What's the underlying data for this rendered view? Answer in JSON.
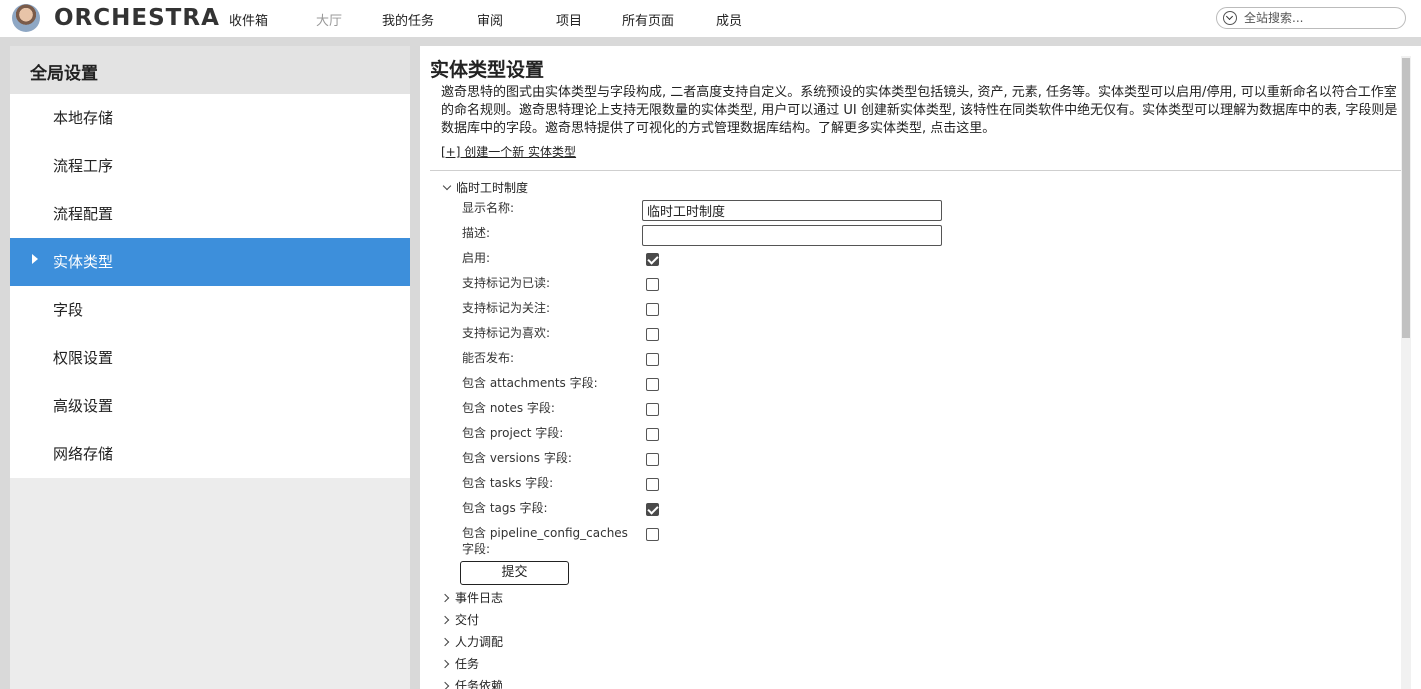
{
  "app": {
    "brand": "ORCHESTRA",
    "avatar_icon": "user-avatar-icon"
  },
  "nav": [
    {
      "label": "收件箱",
      "enabled": true
    },
    {
      "label": "大厅",
      "enabled": false
    },
    {
      "label": "我的任务",
      "enabled": true
    },
    {
      "label": "审阅",
      "enabled": true
    },
    {
      "label": "项目",
      "enabled": true
    },
    {
      "label": "所有页面",
      "enabled": true
    },
    {
      "label": "成员",
      "enabled": true
    }
  ],
  "search": {
    "placeholder": "全站搜索..."
  },
  "sidebar": {
    "title": "全局设置",
    "items": [
      {
        "label": "本地存储"
      },
      {
        "label": "流程工序"
      },
      {
        "label": "流程配置"
      },
      {
        "label": "实体类型",
        "active": true
      },
      {
        "label": "字段"
      },
      {
        "label": "权限设置"
      },
      {
        "label": "高级设置"
      },
      {
        "label": "网络存储"
      }
    ]
  },
  "main": {
    "title": "实体类型设置",
    "description": "邀奇思特的图式由实体类型与字段构成, 二者高度支持自定义。系统预设的实体类型包括镜头, 资产, 元素, 任务等。实体类型可以启用/停用, 可以重新命名以符合工作室的命名规则。邀奇思特理论上支持无限数量的实体类型, 用户可以通过 UI 创建新实体类型, 该特性在同类软件中绝无仅有。实体类型可以理解为数据库中的表, 字段则是数据库中的字段。邀奇思特提供了可视化的方式管理数据库结构。了解更多实体类型, 点击这里。",
    "create_link": "[+] 创建一个新 实体类型",
    "expanded_section": {
      "title": "临时工时制度",
      "fields": {
        "display_name": {
          "label": "显示名称:",
          "value": "临时工时制度"
        },
        "description": {
          "label": "描述:",
          "value": ""
        }
      },
      "checkboxes": [
        {
          "label": "启用:",
          "checked": true
        },
        {
          "label": "支持标记为已读:",
          "checked": false
        },
        {
          "label": "支持标记为关注:",
          "checked": false
        },
        {
          "label": "支持标记为喜欢:",
          "checked": false
        },
        {
          "label": "能否发布:",
          "checked": false
        },
        {
          "label": "包含 attachments 字段:",
          "checked": false
        },
        {
          "label": "包含 notes 字段:",
          "checked": false
        },
        {
          "label": "包含 project 字段:",
          "checked": false
        },
        {
          "label": "包含 versions 字段:",
          "checked": false
        },
        {
          "label": "包含 tasks 字段:",
          "checked": false
        },
        {
          "label": "包含 tags 字段:",
          "checked": true
        },
        {
          "label": "包含 pipeline_config_caches 字段:",
          "checked": false
        }
      ],
      "submit_label": "提交"
    },
    "collapsed_sections": [
      {
        "title": "事件日志"
      },
      {
        "title": "交付"
      },
      {
        "title": "人力调配"
      },
      {
        "title": "任务"
      },
      {
        "title": "任务依赖"
      }
    ]
  }
}
